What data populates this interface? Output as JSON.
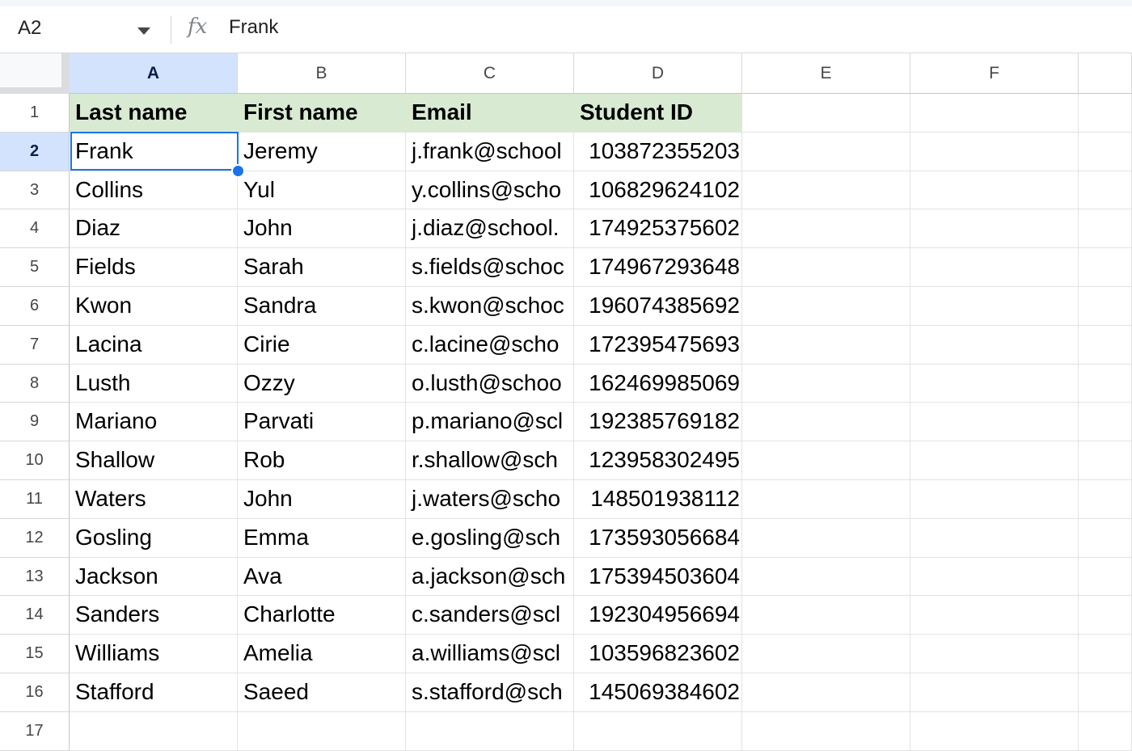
{
  "formula_bar": {
    "name_box": "A2",
    "fx_label": "fx",
    "formula": "Frank"
  },
  "columns": [
    "A",
    "B",
    "C",
    "D",
    "E",
    "F"
  ],
  "selected_column": "A",
  "selected_row": 2,
  "rows": [
    {
      "num": "1",
      "cells": [
        "Last name",
        "First name",
        "Email",
        "Student ID"
      ]
    },
    {
      "num": "2",
      "cells": [
        "Frank",
        "Jeremy",
        "j.frank@school",
        "103872355203"
      ]
    },
    {
      "num": "3",
      "cells": [
        "Collins",
        "Yul",
        "y.collins@scho",
        "106829624102"
      ]
    },
    {
      "num": "4",
      "cells": [
        "Diaz",
        "John",
        "j.diaz@school.",
        "174925375602"
      ]
    },
    {
      "num": "5",
      "cells": [
        "Fields",
        "Sarah",
        "s.fields@schoc",
        "174967293648"
      ]
    },
    {
      "num": "6",
      "cells": [
        "Kwon",
        "Sandra",
        "s.kwon@schoc",
        "196074385692"
      ]
    },
    {
      "num": "7",
      "cells": [
        "Lacina",
        "Cirie",
        "c.lacine@scho",
        "172395475693"
      ]
    },
    {
      "num": "8",
      "cells": [
        "Lusth",
        "Ozzy",
        "o.lusth@schoo",
        "162469985069"
      ]
    },
    {
      "num": "9",
      "cells": [
        "Mariano",
        "Parvati",
        "p.mariano@scl",
        "192385769182"
      ]
    },
    {
      "num": "10",
      "cells": [
        "Shallow",
        "Rob",
        "r.shallow@sch",
        "123958302495"
      ]
    },
    {
      "num": "11",
      "cells": [
        "Waters",
        "John",
        "j.waters@scho",
        "148501938112"
      ]
    },
    {
      "num": "12",
      "cells": [
        "Gosling",
        "Emma",
        "e.gosling@sch",
        "173593056684"
      ]
    },
    {
      "num": "13",
      "cells": [
        "Jackson",
        "Ava",
        "a.jackson@sch",
        "175394503604"
      ]
    },
    {
      "num": "14",
      "cells": [
        "Sanders",
        "Charlotte",
        "c.sanders@scl",
        "192304956694"
      ]
    },
    {
      "num": "15",
      "cells": [
        "Williams",
        "Amelia",
        "a.williams@scl",
        "103596823602"
      ]
    },
    {
      "num": "16",
      "cells": [
        "Stafford",
        "Saeed",
        "s.stafford@sch",
        "145069384602"
      ]
    },
    {
      "num": "17",
      "cells": [
        "",
        "",
        "",
        ""
      ]
    }
  ],
  "colors": {
    "header_fill": "#d9ead3",
    "selection": "#1a73e8",
    "selected_header": "#d3e3fd"
  }
}
